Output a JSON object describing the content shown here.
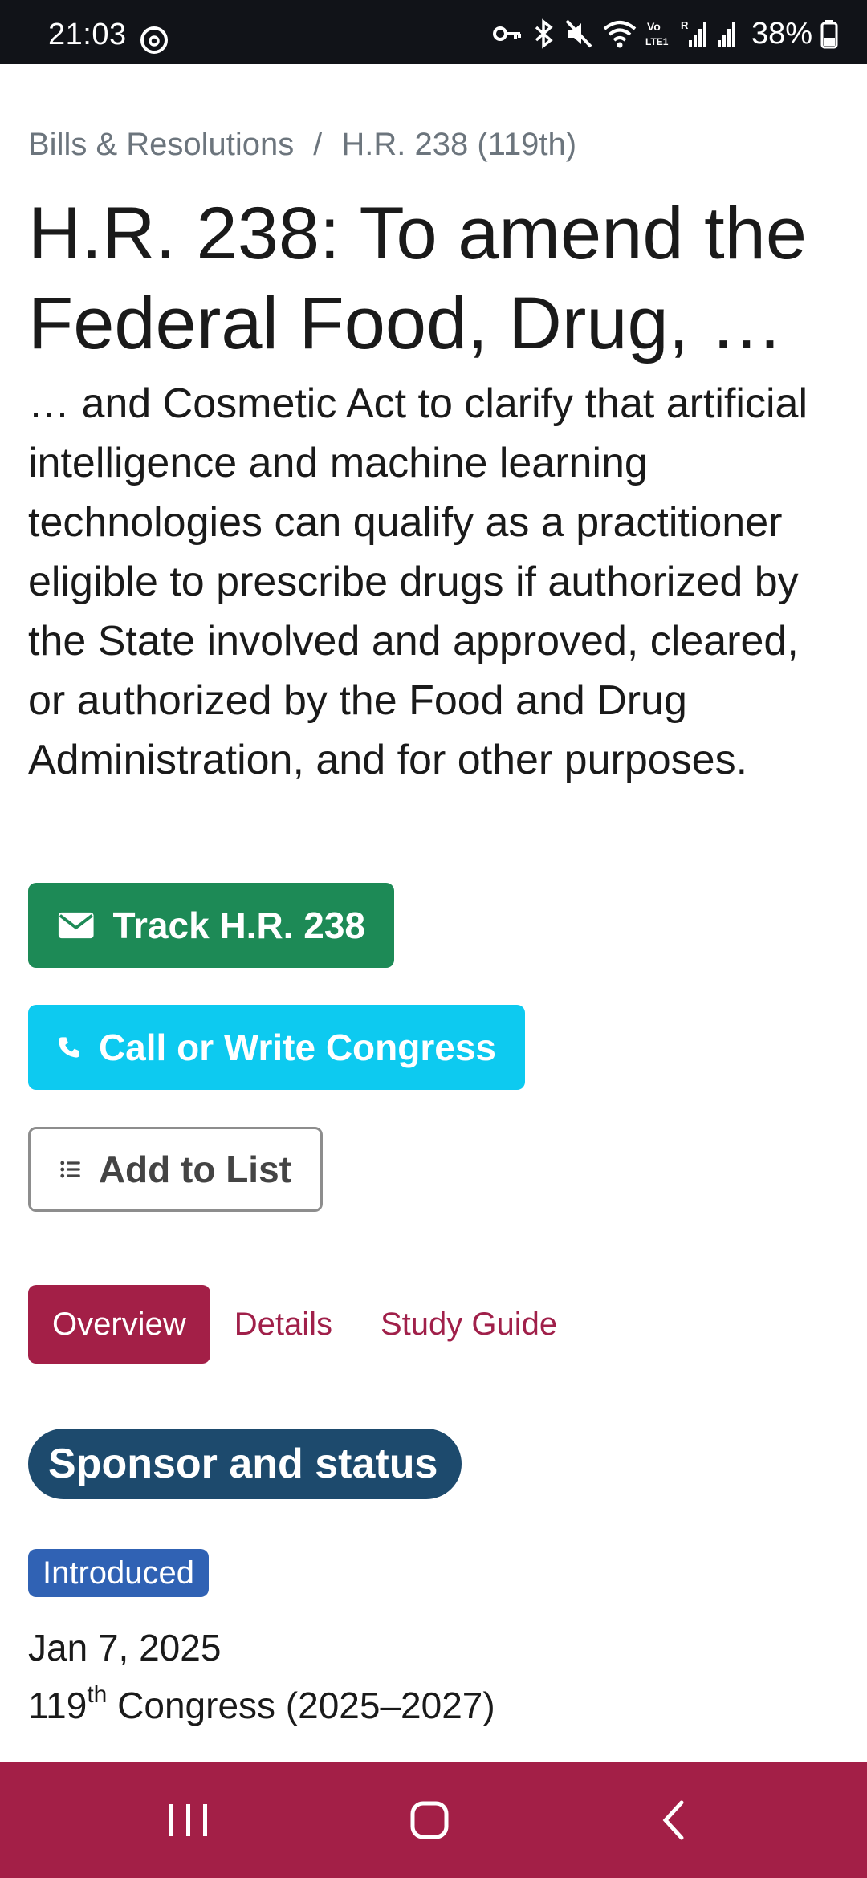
{
  "status_bar": {
    "time": "21:03",
    "battery": "38%",
    "icons": [
      "threads-icon",
      "vpn-key-icon",
      "bluetooth-icon",
      "mute-icon",
      "wifi-icon",
      "volte-icon",
      "signal-icon",
      "signal-icon",
      "battery-icon"
    ],
    "volte_label_top": "Vo",
    "volte_label_bottom": "LTE1",
    "signal_label": "R"
  },
  "breadcrumb": {
    "parent": "Bills & Resolutions",
    "separator": "/",
    "current": "H.R. 238 (119th)"
  },
  "title": "H.R. 238: To amend the Federal Food, Drug, …",
  "description": "… and Cosmetic Act to clarify that artificial intelligence and machine learning technologies can qualify as a practitioner eligible to prescribe drugs if authorized by the State involved and approved, cleared, or authorized by the Food and Drug Administration, and for other purposes.",
  "actions": {
    "track_label": "Track H.R. 238",
    "call_label": "Call or Write Congress",
    "list_label": "Add to List"
  },
  "tabs": [
    {
      "label": "Overview",
      "active": true
    },
    {
      "label": "Details",
      "active": false
    },
    {
      "label": "Study Guide",
      "active": false
    }
  ],
  "section": {
    "heading": "Sponsor and status",
    "status": "Introduced",
    "date": "Jan 7, 2025",
    "congress_number": "119",
    "congress_suffix": "th",
    "congress_rest": " Congress (2025–2027)"
  },
  "colors": {
    "track_button": "#1d8a56",
    "call_button": "#0dcaf0",
    "active_tab": "#a31f47",
    "section_pill": "#1d4a6d",
    "status_badge": "#3062b4",
    "nav_bar": "#a31f47"
  },
  "nav": [
    "recents-icon",
    "home-icon",
    "back-icon"
  ]
}
